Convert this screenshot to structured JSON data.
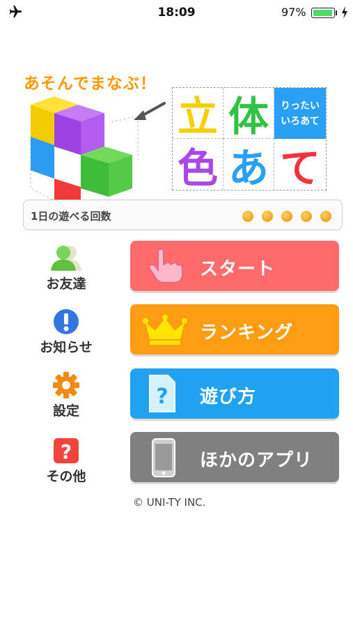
{
  "status_bar": {
    "time": "18:09",
    "battery_percent_text": "97%",
    "battery_level": 0.97
  },
  "header": {
    "tagline": "あそんでまなぶ！",
    "title_chars": [
      "立",
      "体",
      "色",
      "あ",
      "て"
    ],
    "title_colors": [
      "#f5d000",
      "#2fc244",
      "#a848e8",
      "#2aa0f5",
      "#f2333d"
    ],
    "subtitle_lines": [
      "りったい",
      "いろあて"
    ]
  },
  "daily_plays": {
    "label": "1日の遊べる回数",
    "count": 5
  },
  "side_menu": [
    {
      "id": "friends",
      "label": "お友達",
      "icon": "people-icon"
    },
    {
      "id": "news",
      "label": "お知らせ",
      "icon": "info-exclamation-icon"
    },
    {
      "id": "settings",
      "label": "設定",
      "icon": "gear-icon"
    },
    {
      "id": "other",
      "label": "その他",
      "icon": "question-icon"
    }
  ],
  "main_buttons": [
    {
      "id": "start",
      "label": "スタート",
      "icon": "pointing-hand-icon",
      "color": "#ff6b6b"
    },
    {
      "id": "ranking",
      "label": "ランキング",
      "icon": "crown-icon",
      "color": "#ff9c12"
    },
    {
      "id": "howto",
      "label": "遊び方",
      "icon": "help-document-icon",
      "color": "#1fa3f0"
    },
    {
      "id": "other_apps",
      "label": "ほかのアプリ",
      "icon": "smartphone-icon",
      "color": "#808080"
    }
  ],
  "footer": {
    "copyright": "© UNI-TY INC."
  }
}
